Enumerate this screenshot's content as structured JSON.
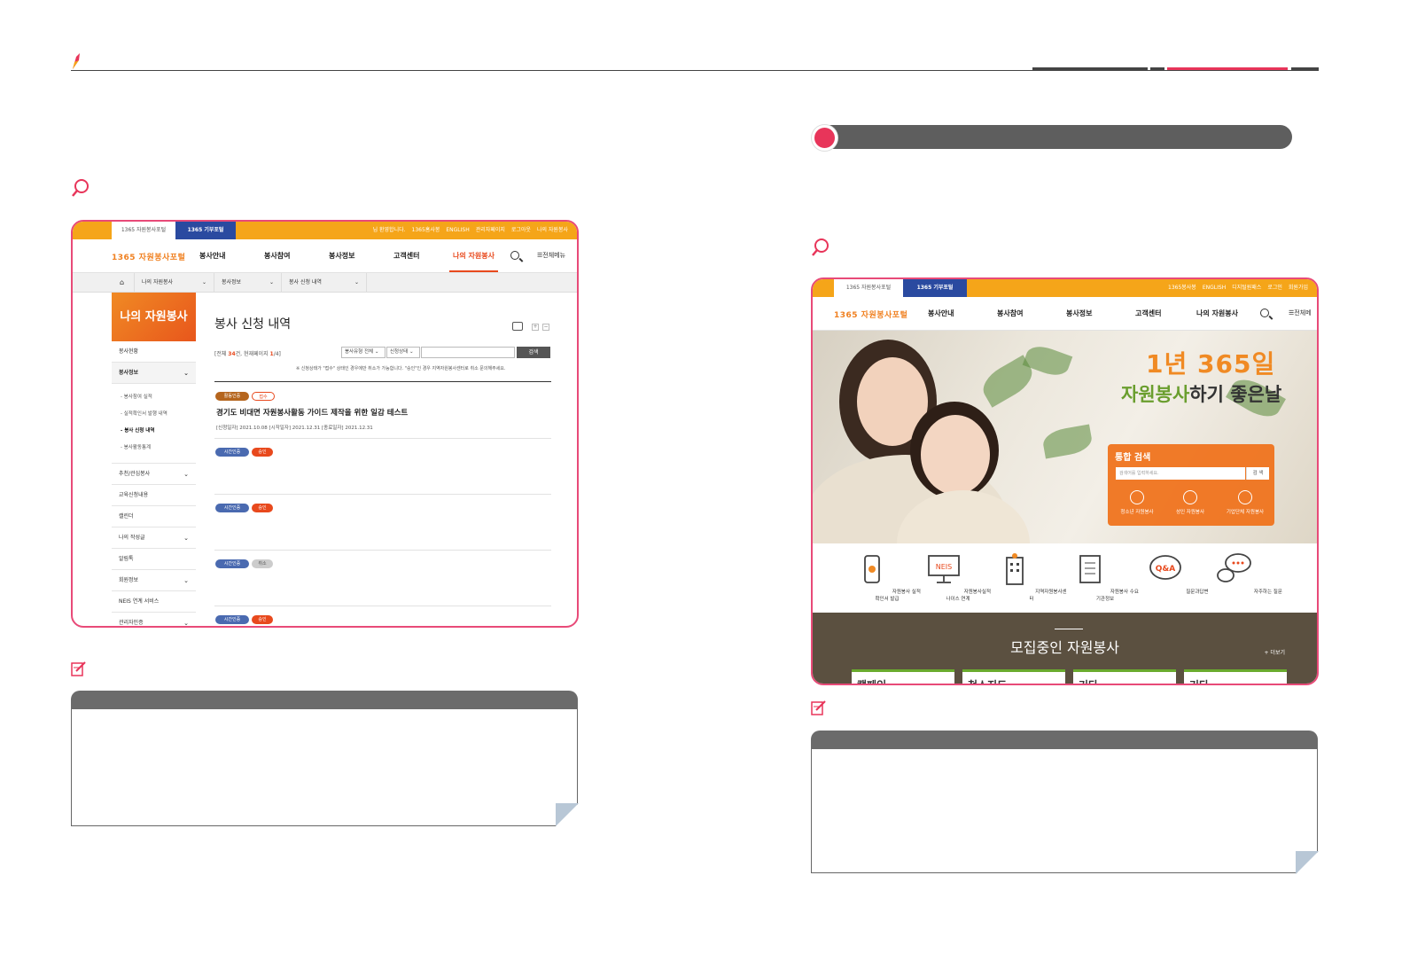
{
  "colors": {
    "accent": "#e8355a",
    "orange": "#f5a519",
    "navy": "#2a4aa0",
    "green": "#6aab2e",
    "brown": "#5b5040",
    "gray": "#6b6b6b"
  },
  "left_screen": {
    "topbar": {
      "tab1": "1365 자원봉사포털",
      "tab2": "1365 기부포털",
      "links": [
        "님 환영합니다.",
        "1365홈사봉",
        "ENGLISH",
        "관리자페이지",
        "로그아웃",
        "나의 자원봉사"
      ]
    },
    "logo": "1365 자원봉사포털",
    "menu": [
      "봉사안내",
      "봉사참여",
      "봉사정보",
      "고객센터",
      "나의 자원봉사"
    ],
    "all_menu": "전체메뉴",
    "breadcrumb": [
      "나의 자원봉사",
      "봉사정보",
      "봉사 신청 내역"
    ],
    "lnb_title": "나의 자원봉사",
    "lnb": {
      "i0": "봉사현황",
      "i1": "봉사정보",
      "s0": "- 봉사참여 실적",
      "s1": "- 실적확인서 발행 내역",
      "s2": "- 봉사 신청 내역",
      "s3": "- 봉사활동통계",
      "i2": "추천/관심봉사",
      "i3": "교육신청내용",
      "i4": "캘린더",
      "i5": "나의 작성글",
      "i6": "알림톡",
      "i7": "회원정보",
      "i8": "NEIS 연계 서비스",
      "i9": "관리자인증"
    },
    "page_title": "봉사 신청 내역",
    "count": {
      "pre": "[전체 ",
      "total": "34",
      "mid": "건, 현재페이지 ",
      "page": "1",
      "post": "/4]"
    },
    "filters": [
      "봉사유형 전체",
      "신청상태"
    ],
    "search_btn": "검색",
    "notice": "※ 신청상태가 \"접수\" 상태인 경우에만 취소가 가능합니다. \"승인\"인 경우 지역자원봉사센터로 취소 문의해주세요.",
    "items": [
      {
        "badge1": "활동인증",
        "badge2": "접수",
        "title": "경기도 비대면 자원봉사활동 가이드 제작을 위한 일감 테스트",
        "dates": "[신청일자] 2021.10.08   [시작일자] 2021.12.31   [종료일자] 2021.12.31"
      },
      {
        "badge1": "시간인증",
        "badge2": "승인"
      },
      {
        "badge1": "시간인증",
        "badge2": "승인"
      },
      {
        "badge1": "시간인증",
        "badge2": "취소"
      },
      {
        "badge1": "시간인증",
        "badge2": "승인"
      }
    ]
  },
  "right_screen": {
    "topbar": {
      "tab1": "1365 자원봉사포털",
      "tab2": "1365 기부포털",
      "links": [
        "1365봉사봉",
        "ENGLISH",
        "디지털원패스",
        "로그인",
        "회원가입"
      ]
    },
    "logo": "1365 자원봉사포털",
    "menu": [
      "봉사안내",
      "봉사참여",
      "봉사정보",
      "고객센터",
      "나의 자원봉사"
    ],
    "all_menu": "전체메",
    "headline_a": "1년 365일",
    "headline_b1": "자원봉사",
    "headline_b2": "하기 좋은날",
    "search": {
      "title": "통합 검색",
      "placeholder": "검색어를 입력하세요.",
      "button": "검 색",
      "items": [
        "청소년 자원봉사",
        "성인 자원봉사",
        "기업단체 자원봉사"
      ]
    },
    "services": [
      "자원봉사 실적확인서 발급",
      "자원봉사실적 나이스 연계",
      "지역자원봉사센터",
      "자원봉사 수요기관정보",
      "질문과답변",
      "자주하는 질문"
    ],
    "neis": "NEIS",
    "qa": "Q&A",
    "recruit_title": "모집중인 자원봉사",
    "more": "+ 더보기",
    "cards": [
      "캠페인",
      "청소지도",
      "기타",
      "기타"
    ]
  }
}
